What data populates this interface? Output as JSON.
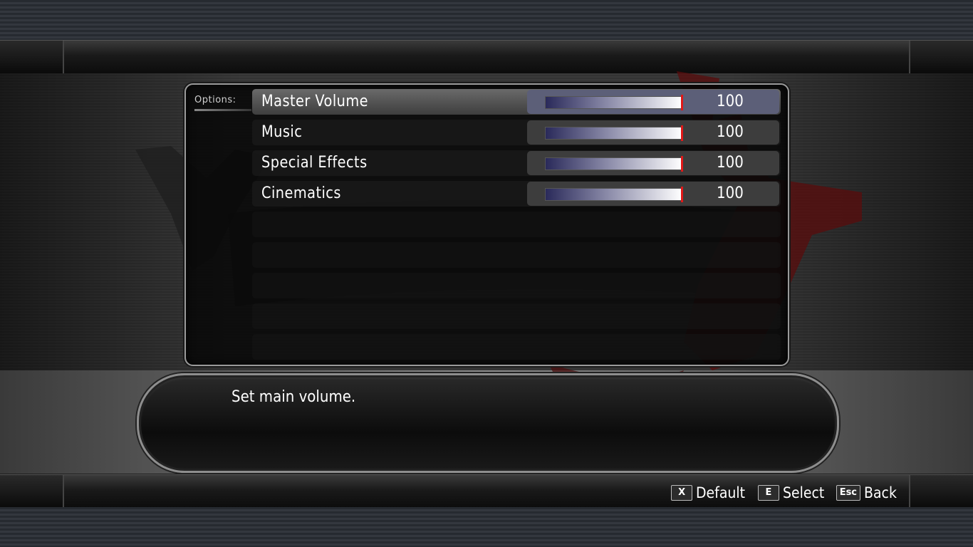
{
  "options_label": "Options:",
  "settings": [
    {
      "label": "Master Volume",
      "value": "100",
      "level": 1.0,
      "selected": true
    },
    {
      "label": "Music",
      "value": "100",
      "level": 1.0,
      "selected": false
    },
    {
      "label": "Special Effects",
      "value": "100",
      "level": 1.0,
      "selected": false
    },
    {
      "label": "Cinematics",
      "value": "100",
      "level": 1.0,
      "selected": false
    }
  ],
  "description": "Set main volume.",
  "hints": [
    {
      "key": "X",
      "label": "Default"
    },
    {
      "key": "E",
      "label": "Select"
    },
    {
      "key": "Esc",
      "label": "Back"
    }
  ],
  "colors": {
    "slider_marker": "#e01818",
    "selected_row": "#6a6a6a",
    "selected_slider_bg": "#5c5f78"
  }
}
